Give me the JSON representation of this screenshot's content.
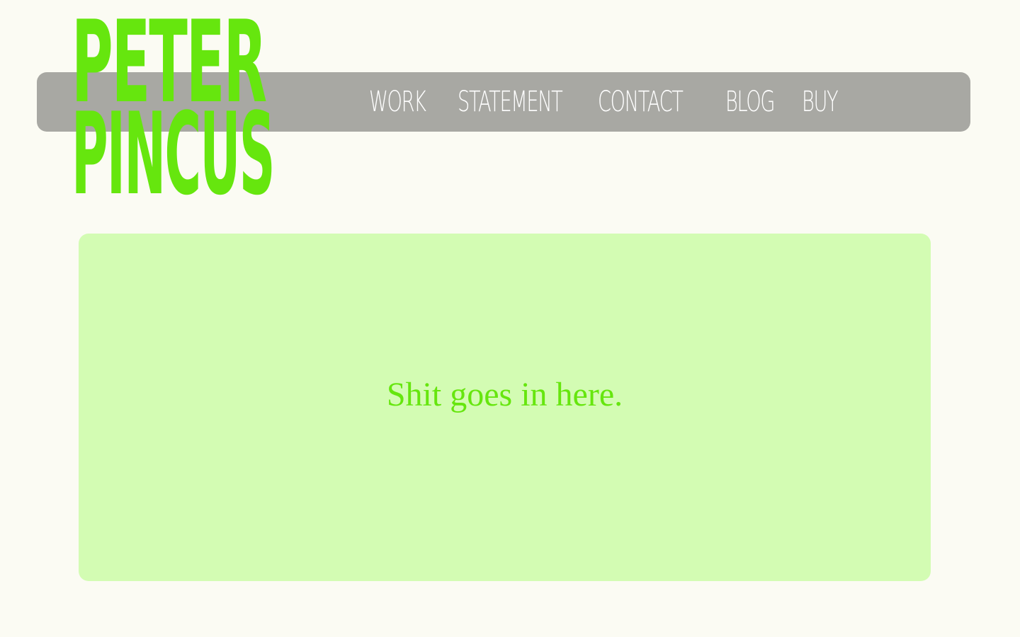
{
  "logo": {
    "line1": "PETER",
    "line2": "PINCUS",
    "color": "#66e60e"
  },
  "nav": {
    "items": [
      {
        "label": "WORK"
      },
      {
        "label": "STATEMENT"
      },
      {
        "label": "CONTACT"
      },
      {
        "label": "BLOG"
      },
      {
        "label": "BUY"
      }
    ],
    "background": "#a8a8a3",
    "text_color": "#ffffff"
  },
  "main": {
    "placeholder_text": "Shit goes in here.",
    "panel_color": "#d3fcb3"
  },
  "page": {
    "background": "#fbfbf3"
  }
}
